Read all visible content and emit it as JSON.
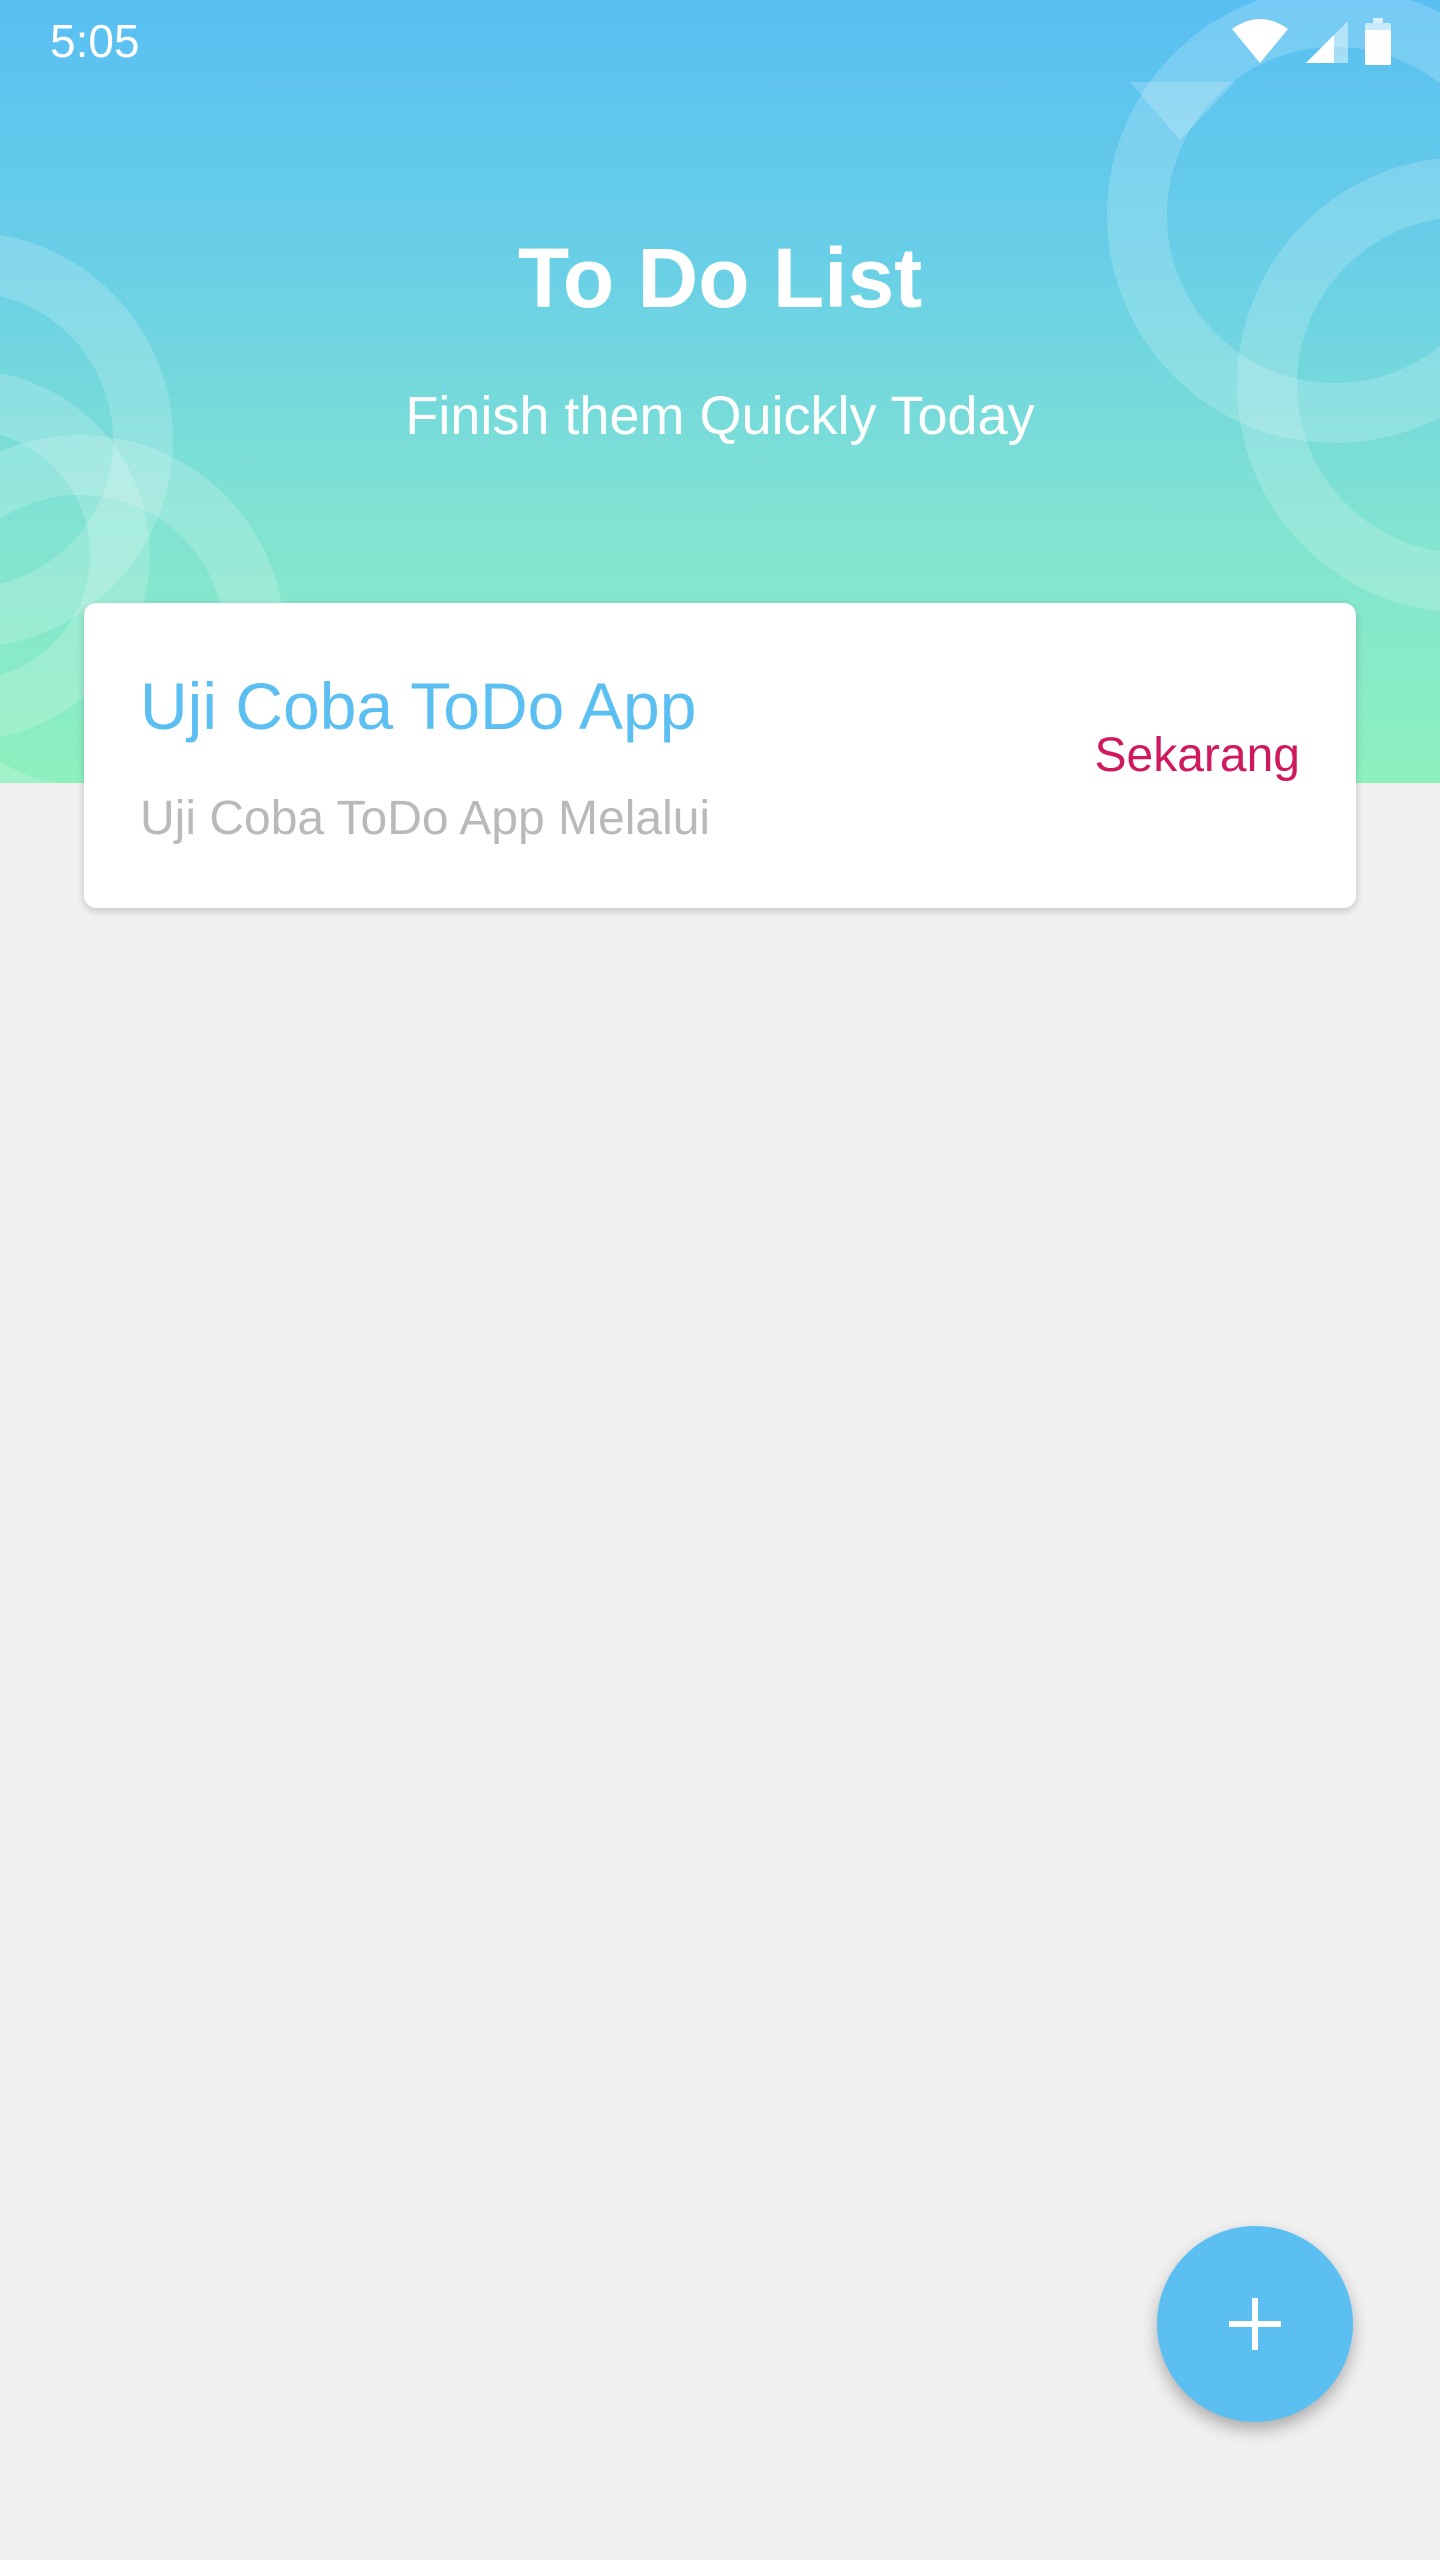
{
  "status_bar": {
    "time": "5:05",
    "icons": [
      "wifi-icon",
      "cell-signal-icon",
      "battery-icon"
    ]
  },
  "header": {
    "title": "To Do List",
    "subtitle": "Finish them Quickly Today"
  },
  "todos": [
    {
      "title": "Uji Coba ToDo App",
      "description": "Uji Coba ToDo App Melalui",
      "time": "Sekarang"
    }
  ],
  "fab": {
    "icon": "plus-icon"
  },
  "colors": {
    "accent": "#5bbff2",
    "time_label": "#d0185f",
    "background": "#f0f0f0",
    "gradient_top": "#58bff3",
    "gradient_bottom": "#8ef0be",
    "description": "#b9b9b9"
  }
}
